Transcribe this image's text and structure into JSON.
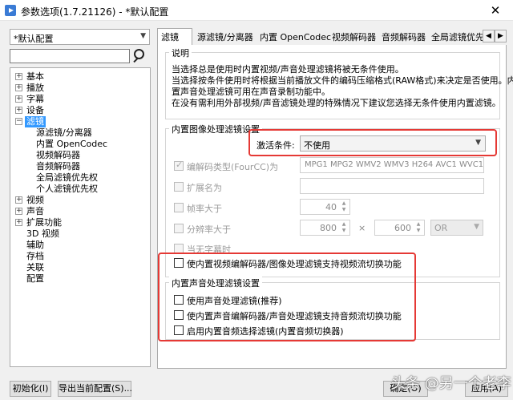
{
  "window": {
    "title": "参数选项(1.7.21126) - *默认配置",
    "close_label": "✕"
  },
  "profile": {
    "value": "*默认配置"
  },
  "search": {
    "value": "",
    "placeholder": ""
  },
  "tree": {
    "items": [
      {
        "label": "基本",
        "expander": "+"
      },
      {
        "label": "播放",
        "expander": "+"
      },
      {
        "label": "字幕",
        "expander": "+"
      },
      {
        "label": "设备",
        "expander": "+"
      },
      {
        "label": "滤镜",
        "expander": "−",
        "selected": true
      },
      {
        "label": "源滤镜/分离器"
      },
      {
        "label": "内置 OpenCodec"
      },
      {
        "label": "视频解码器"
      },
      {
        "label": "音频解码器"
      },
      {
        "label": "全局滤镜优先权"
      },
      {
        "label": "个人滤镜优先权"
      },
      {
        "label": "视频",
        "expander": "+"
      },
      {
        "label": "声音",
        "expander": "+"
      },
      {
        "label": "扩展功能",
        "expander": "+"
      },
      {
        "label": "3D 视频"
      },
      {
        "label": "辅助"
      },
      {
        "label": "存档"
      },
      {
        "label": "关联"
      },
      {
        "label": "配置"
      }
    ]
  },
  "tabs": [
    "滤镜",
    "源滤镜/分离器",
    "内置 OpenCodec",
    "视频解码器",
    "音频解码器",
    "全局滤镜优先"
  ],
  "description": {
    "title": "说明",
    "lines": [
      "当选择总是使用时内置视频/声音处理滤镜将被无条件使用。",
      "当选择按条件使用时将根据当前播放文件的编码压缩格式(RAW格式)来决定是否使用。内",
      "置声音处理滤镜可用在声音录制功能中。",
      "在没有需利用外部视频/声音滤镜处理的特殊情况下建议您选择无条件使用内置滤镜。"
    ]
  },
  "video_group": {
    "title": "内置图像处理滤镜设置",
    "activation_label": "激活条件:",
    "activation_value": "不使用",
    "fourcc_label": "编解码类型(FourCC)为",
    "fourcc_value": "MPG1 MPG2 WMV2 WMV3 H264 AVC1 WVC1",
    "ext_label": "扩展名为",
    "ext_value": "",
    "framerate_label": "帧率大于",
    "framerate_value": "40",
    "resolution_label": "分辨率大于",
    "res_width": "800",
    "res_times": "×",
    "res_height": "600",
    "logic_value": "OR",
    "no_subtitle_label": "当无字幕时",
    "stream_switch_label": "使内置视频编解码器/图像处理滤镜支持视频流切换功能"
  },
  "audio_group": {
    "title": "内置声音处理滤镜设置",
    "options": [
      "使用声音处理滤镜(推荐)",
      "使内置声音编解码器/声音处理滤镜支持音频流切换功能",
      "启用内置音频选择滤镜(内置音频切换器)"
    ]
  },
  "buttons": {
    "init": "初始化(I)",
    "export": "导出当前配置(S)...",
    "ok": "确定(O)",
    "apply": "应用(A)"
  },
  "watermark": "头条 @另一个老李"
}
